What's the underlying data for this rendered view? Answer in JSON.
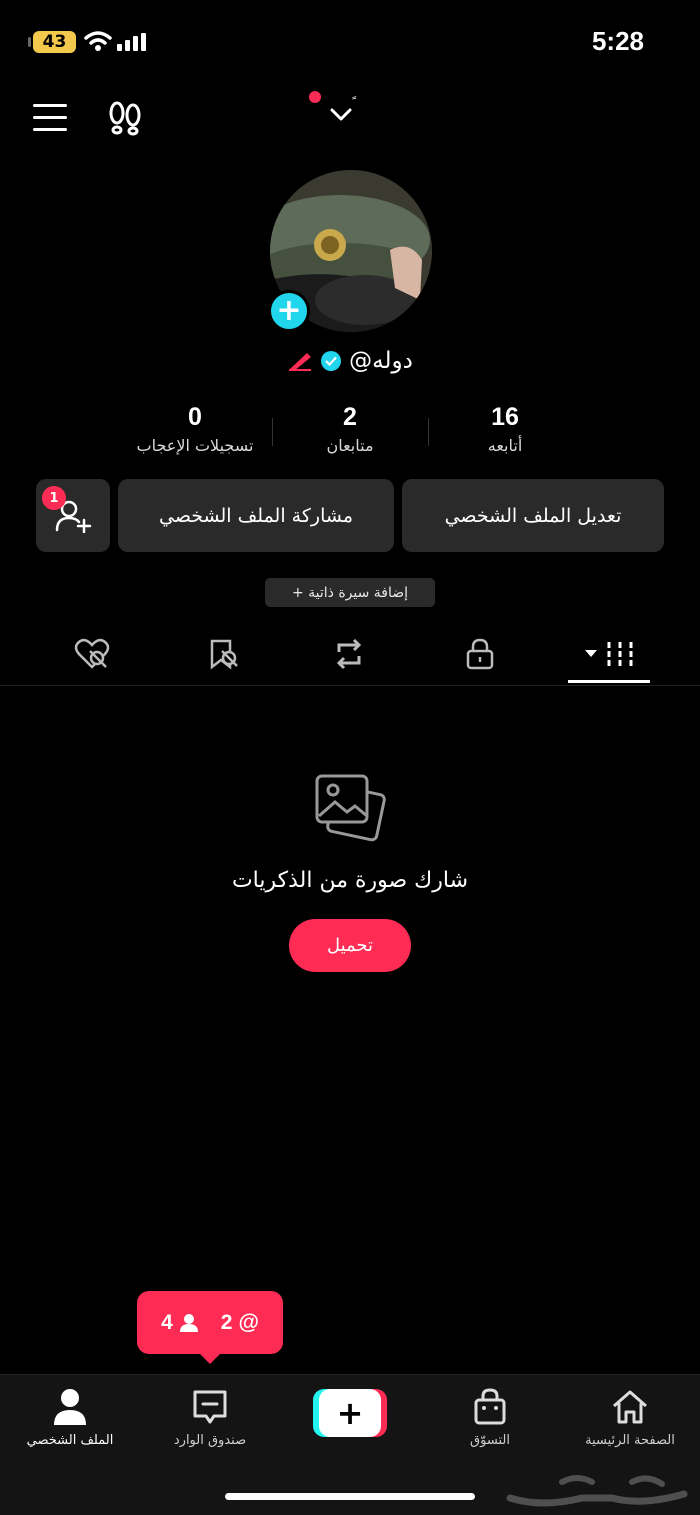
{
  "status_bar": {
    "battery": "43",
    "time": "5:28"
  },
  "profile": {
    "username": "@دوله",
    "stats": [
      {
        "value": "16",
        "label": "أتابعه"
      },
      {
        "value": "2",
        "label": "متابعان"
      },
      {
        "value": "0",
        "label": "تسجيلات الإعجاب"
      }
    ],
    "edit_button": "تعديل الملف الشخصي",
    "share_button": "مشاركة الملف الشخصي",
    "friend_requests_badge": "1",
    "add_bio": "+ إضافة سيرة ذاتية"
  },
  "tabs": [
    "videos",
    "private",
    "reposts",
    "favorites",
    "liked"
  ],
  "empty_state": {
    "title": "شارك صورة من الذكريات",
    "upload_button": "تحميل"
  },
  "activity": {
    "mentions": "2",
    "followers": "4"
  },
  "bottom_nav": {
    "home": "الصفحة الرئيسية",
    "shop": "التسوّق",
    "inbox": "صندوق الوارد",
    "profile": "الملف الشخصي"
  },
  "colors": {
    "accent": "#fe2c55",
    "cyan": "#20d5ec",
    "button_bg": "#2a2a2a"
  }
}
